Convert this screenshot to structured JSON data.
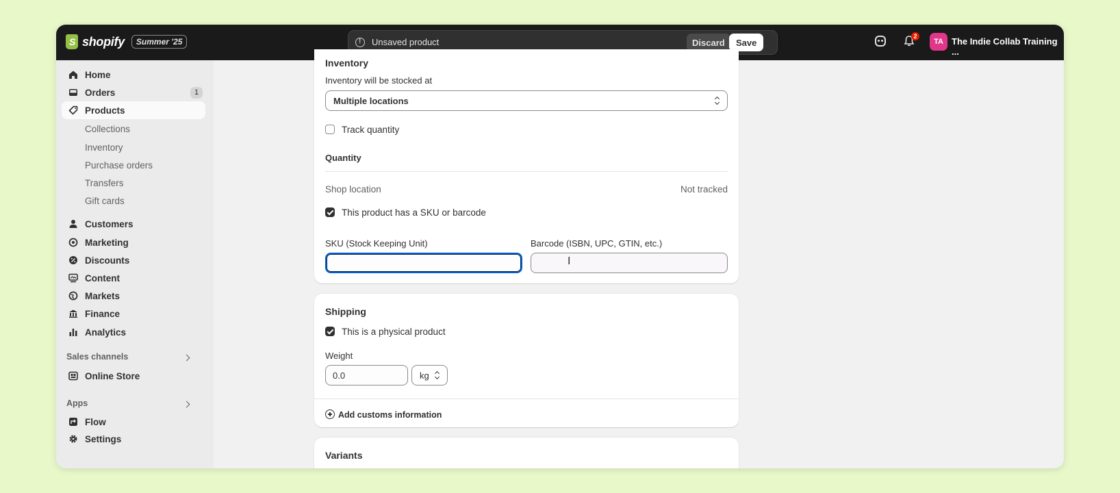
{
  "topbar": {
    "brand": "shopify",
    "edition": "Summer '25",
    "unsaved_text": "Unsaved product",
    "discard_label": "Discard",
    "save_label": "Save",
    "notification_count": "2",
    "avatar_initials": "TA",
    "store_name": "The Indie Collab Training ..."
  },
  "sidebar": {
    "home": "Home",
    "orders": "Orders",
    "orders_badge": "1",
    "products": "Products",
    "sub_items": [
      "Collections",
      "Inventory",
      "Purchase orders",
      "Transfers",
      "Gift cards"
    ],
    "customers": "Customers",
    "marketing": "Marketing",
    "discounts": "Discounts",
    "content": "Content",
    "markets": "Markets",
    "finance": "Finance",
    "analytics": "Analytics",
    "sales_channels": "Sales channels",
    "online_store": "Online Store",
    "apps": "Apps",
    "flow": "Flow",
    "settings": "Settings"
  },
  "inventory": {
    "title": "Inventory",
    "stocked_label": "Inventory will be stocked at",
    "stocked_value": "Multiple locations",
    "track_quantity": "Track quantity",
    "quantity_title": "Quantity",
    "shop_location": "Shop location",
    "not_tracked": "Not tracked",
    "sku_checkbox": "This product has a SKU or barcode",
    "sku_label": "SKU (Stock Keeping Unit)",
    "sku_value": "",
    "barcode_label": "Barcode (ISBN, UPC, GTIN, etc.)",
    "barcode_value": ""
  },
  "shipping": {
    "title": "Shipping",
    "physical_label": "This is a physical product",
    "weight_label": "Weight",
    "weight_value": "0.0",
    "unit_value": "kg",
    "add_customs": "Add customs information"
  },
  "variants": {
    "title": "Variants"
  },
  "colors": {
    "topbar": "#1a1a1a",
    "brand_green": "#95bf47",
    "focus": "#005bd3",
    "avatar": "#e0378a",
    "background": "#e8f8c8"
  }
}
